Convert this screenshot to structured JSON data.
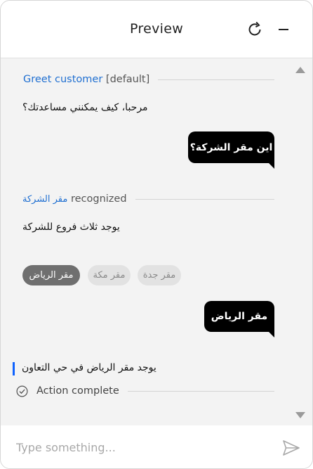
{
  "header": {
    "title": "Preview",
    "refresh_icon": "refresh-icon",
    "minimize_icon": "minimize-icon"
  },
  "conversation": {
    "intent1": {
      "name": "Greet customer",
      "tag": "[default]"
    },
    "bot_greeting": "مرحبا، كيف يمكنني مساعدتك؟",
    "user_msg1": "اين مقر الشركة؟",
    "intent2": {
      "name": "مقر الشركة",
      "status": "recognized"
    },
    "bot_reply1": "يوجد ثلاث فروع للشركة",
    "options": [
      {
        "label": "مقر الرياض",
        "selected": true
      },
      {
        "label": "مقر مكة",
        "selected": false
      },
      {
        "label": "مقر جدة",
        "selected": false
      }
    ],
    "user_msg2": "مقر الرياض",
    "bot_reply2": "يوجد مقر الرياض في حي التعاون",
    "action_status": "Action complete"
  },
  "input": {
    "placeholder": "Type something...",
    "value": ""
  },
  "colors": {
    "link": "#1f6fd1",
    "result_bar": "#0f62fe",
    "bubble": "#000000",
    "chip_selected": "#6f6f6f",
    "chip_normal": "#e2e2e2"
  }
}
